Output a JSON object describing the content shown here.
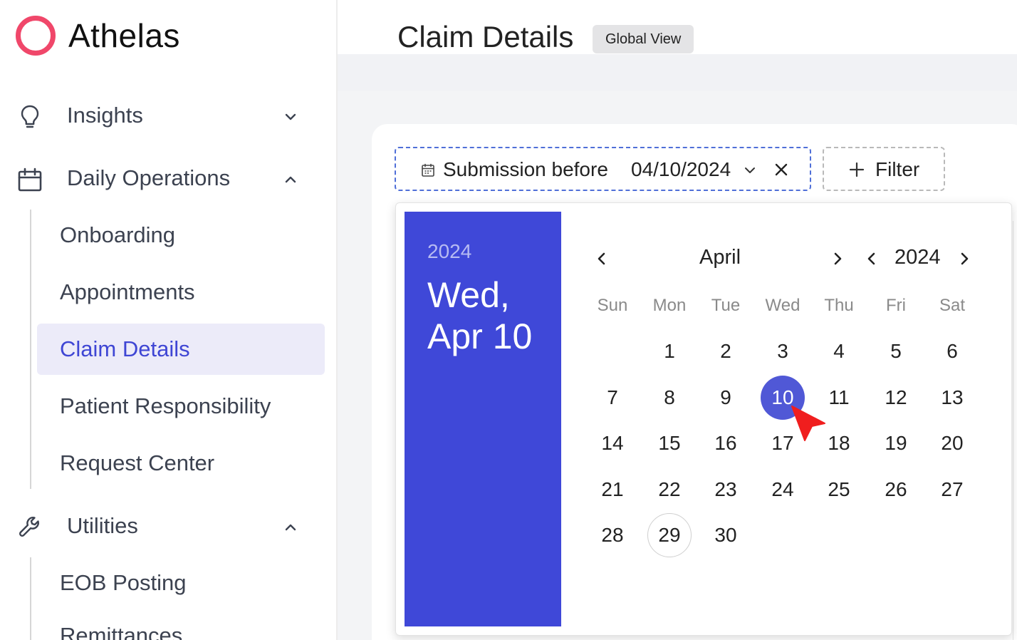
{
  "brand": {
    "name": "Athelas",
    "accent": "#f0476a"
  },
  "sidebar": {
    "groups": [
      {
        "label": "Insights",
        "icon": "lightbulb-icon",
        "expanded": false
      },
      {
        "label": "Daily Operations",
        "icon": "calendar-icon",
        "expanded": true
      },
      {
        "label": "Utilities",
        "icon": "wrench-icon",
        "expanded": true
      }
    ],
    "daily_operations_items": [
      "Onboarding",
      "Appointments",
      "Claim Details",
      "Patient Responsibility",
      "Request Center"
    ],
    "utilities_items": [
      "EOB Posting",
      "Remittances"
    ],
    "active_item": "Claim Details",
    "active_color": "#3f46d4"
  },
  "header": {
    "title": "Claim Details",
    "badge": "Global View"
  },
  "filter_bar": {
    "date_filter_label": "Submission before",
    "date_filter_value": "04/10/2024",
    "add_filter_label": "Filter"
  },
  "date_picker": {
    "side_year": "2024",
    "side_date_line1": "Wed,",
    "side_date_line2": "Apr 10",
    "month": "April",
    "year": "2024",
    "weekdays": [
      "Sun",
      "Mon",
      "Tue",
      "Wed",
      "Thu",
      "Fri",
      "Sat"
    ],
    "days": [
      [
        "",
        "1",
        "2",
        "3",
        "4",
        "5",
        "6"
      ],
      [
        "7",
        "8",
        "9",
        "10",
        "11",
        "12",
        "13"
      ],
      [
        "14",
        "15",
        "16",
        "17",
        "18",
        "19",
        "20"
      ],
      [
        "21",
        "22",
        "23",
        "24",
        "25",
        "26",
        "27"
      ],
      [
        "28",
        "29",
        "30",
        "",
        "",
        "",
        ""
      ]
    ],
    "selected_day": "10",
    "today_day": "29",
    "selected_color": "#5058d6",
    "side_color": "#3f48d8"
  }
}
